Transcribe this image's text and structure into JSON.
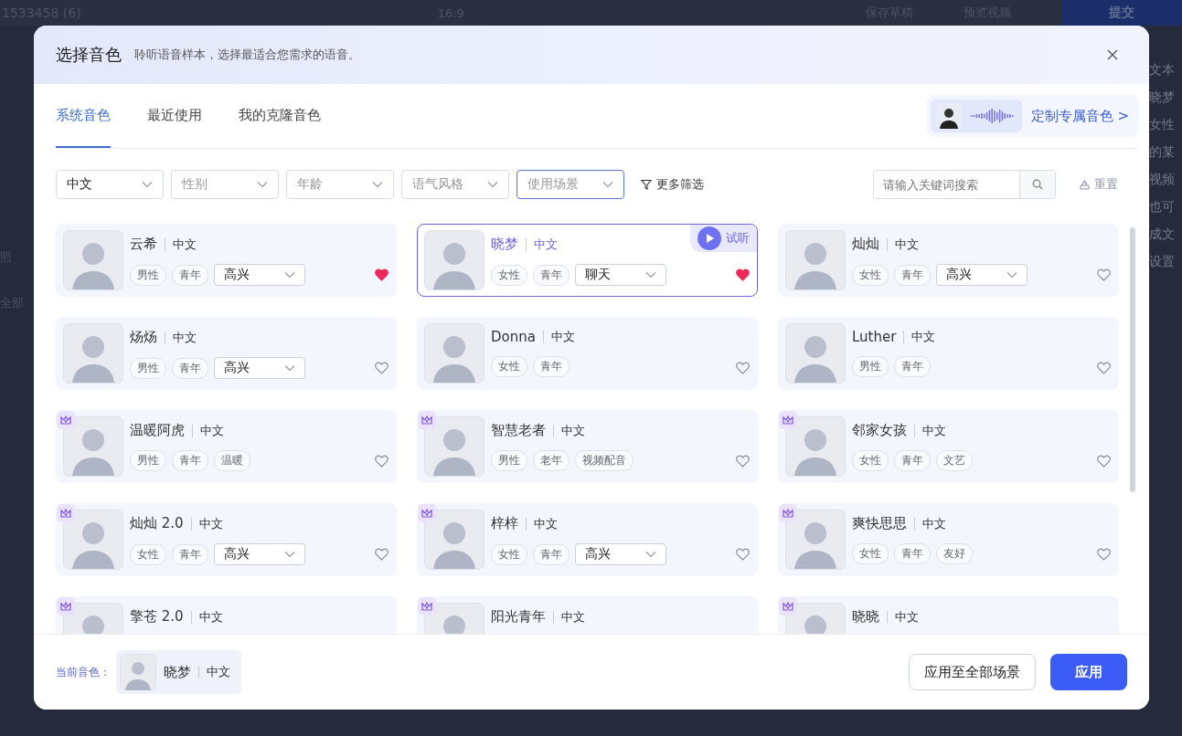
{
  "background": {
    "project_title": "1533458 (6)",
    "ratio": "16:9",
    "save_draft": "保存草稿",
    "preview": "预览视频",
    "submit": "提交",
    "left_texts": [
      "照",
      "全部"
    ],
    "right_texts": [
      "文本",
      "晓梦",
      "女性",
      "的某",
      "视频",
      "也可",
      "成文",
      "设置"
    ]
  },
  "dialog": {
    "title": "选择音色",
    "subtitle": "聆听语音样本，选择最适合您需求的语音。",
    "tabs": [
      {
        "label": "系统音色",
        "selected": true
      },
      {
        "label": "最近使用",
        "selected": false
      },
      {
        "label": "我的克隆音色",
        "selected": false
      }
    ],
    "custom_voice": {
      "label": "定制专属音色 >"
    },
    "filters": [
      {
        "value": "中文",
        "active": false
      },
      {
        "placeholder": "性别",
        "active": false
      },
      {
        "placeholder": "年龄",
        "active": false
      },
      {
        "placeholder": "语气风格",
        "active": false
      },
      {
        "placeholder": "使用场景",
        "active": true
      }
    ],
    "more_filters": "更多筛选",
    "search": {
      "placeholder": "请输入关键词搜索"
    },
    "reset": "重置",
    "voices": [
      {
        "name": "云希",
        "lang": "中文",
        "tags": [
          "男性",
          "青年"
        ],
        "style": "高兴",
        "liked": true,
        "selected": false,
        "premium": false
      },
      {
        "name": "晓梦",
        "lang": "中文",
        "tags": [
          "女性",
          "青年"
        ],
        "style": "聊天",
        "liked": true,
        "selected": true,
        "premium": false,
        "preview": "试听"
      },
      {
        "name": "灿灿",
        "lang": "中文",
        "tags": [
          "女性",
          "青年"
        ],
        "style": "高兴",
        "liked": false,
        "selected": false,
        "premium": false
      },
      {
        "name": "炀炀",
        "lang": "中文",
        "tags": [
          "男性",
          "青年"
        ],
        "style": "高兴",
        "liked": false,
        "selected": false,
        "premium": false
      },
      {
        "name": "Donna",
        "lang": "中文",
        "tags": [
          "女性",
          "青年"
        ],
        "liked": false,
        "selected": false,
        "premium": false
      },
      {
        "name": "Luther",
        "lang": "中文",
        "tags": [
          "男性",
          "青年"
        ],
        "liked": false,
        "selected": false,
        "premium": false
      },
      {
        "name": "温暖阿虎",
        "lang": "中文",
        "tags": [
          "男性",
          "青年",
          "温暖"
        ],
        "liked": false,
        "selected": false,
        "premium": true
      },
      {
        "name": "智慧老者",
        "lang": "中文",
        "tags": [
          "男性",
          "老年",
          "视频配音"
        ],
        "liked": false,
        "selected": false,
        "premium": true
      },
      {
        "name": "邻家女孩",
        "lang": "中文",
        "tags": [
          "女性",
          "青年",
          "文艺"
        ],
        "liked": false,
        "selected": false,
        "premium": true
      },
      {
        "name": "灿灿 2.0",
        "lang": "中文",
        "tags": [
          "女性",
          "青年"
        ],
        "style": "高兴",
        "liked": false,
        "selected": false,
        "premium": true
      },
      {
        "name": "梓梓",
        "lang": "中文",
        "tags": [
          "女性",
          "青年"
        ],
        "style": "高兴",
        "liked": false,
        "selected": false,
        "premium": true
      },
      {
        "name": "爽快思思",
        "lang": "中文",
        "tags": [
          "女性",
          "青年",
          "友好"
        ],
        "liked": false,
        "selected": false,
        "premium": true
      },
      {
        "name": "擎苍 2.0",
        "lang": "中文",
        "premium": true,
        "selected": false
      },
      {
        "name": "阳光青年",
        "lang": "中文",
        "premium": true,
        "selected": false
      },
      {
        "name": "晓晓",
        "lang": "中文",
        "premium": true,
        "selected": false
      }
    ],
    "current": {
      "label": "当前音色：",
      "name": "晓梦",
      "lang": "中文"
    },
    "buttons": [
      {
        "label": "应用至全部场景",
        "kind": "secondary"
      },
      {
        "label": "应用",
        "kind": "primary"
      }
    ]
  }
}
